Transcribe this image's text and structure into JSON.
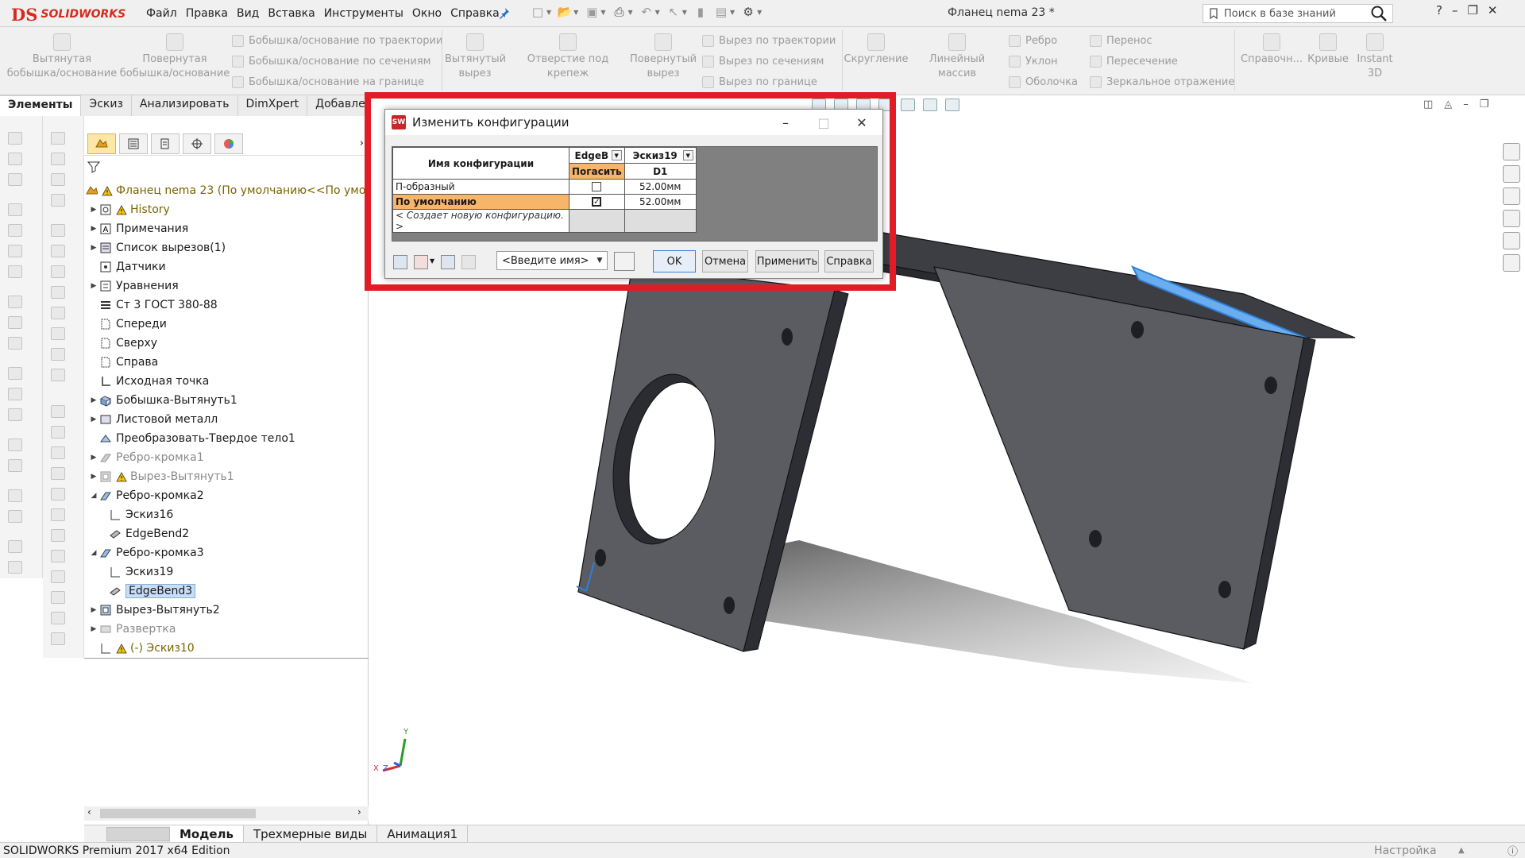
{
  "app": {
    "logo_prefix": "DS",
    "logo_text": "SOLIDWORKS",
    "menus": [
      "Файл",
      "Правка",
      "Вид",
      "Вставка",
      "Инструменты",
      "Окно",
      "Справка"
    ],
    "document_title": "Фланец nema 23 *",
    "search_placeholder": "Поиск в базе знаний",
    "help_glyph": "?"
  },
  "command_manager": {
    "buttons_big": [
      {
        "label": "Вытянутая бобышка/основание"
      },
      {
        "label": "Повернутая бобышка/основание"
      },
      {
        "label": "Вытянутый вырез"
      },
      {
        "label": "Отверстие под крепеж"
      },
      {
        "label": "Повернутый вырез"
      },
      {
        "label": "Скругление"
      },
      {
        "label": "Линейный массив"
      },
      {
        "label": "Справочн..."
      },
      {
        "label": "Кривые"
      },
      {
        "label": "Instant 3D"
      }
    ],
    "buttons_small": [
      "Бобышка/основание по траектории",
      "Бобышка/основание по сечениям",
      "Бобышка/основание на границе",
      "Вырез по траектории",
      "Вырез по сечениям",
      "Вырез по границе",
      "Ребро",
      "Уклон",
      "Оболочка",
      "Перенос",
      "Пересечение",
      "Зеркальное отражение"
    ]
  },
  "tabs": [
    "Элементы",
    "Эскиз",
    "Анализировать",
    "DimXpert",
    "Добавления SOLIDWORKS"
  ],
  "feature_tree": {
    "root": "Фланец nema 23  (По умолчанию<<По умо",
    "items": [
      {
        "label": "History"
      },
      {
        "label": "Примечания"
      },
      {
        "label": "Список вырезов(1)"
      },
      {
        "label": "Датчики"
      },
      {
        "label": "Уравнения"
      },
      {
        "label": "Ст 3 ГОСТ 380-88"
      },
      {
        "label": "Спереди"
      },
      {
        "label": "Сверху"
      },
      {
        "label": "Справа"
      },
      {
        "label": "Исходная точка"
      },
      {
        "label": "Бобышка-Вытянуть1"
      },
      {
        "label": "Листовой металл"
      },
      {
        "label": "Преобразовать-Твердое тело1"
      },
      {
        "label": "Ребро-кромка1"
      },
      {
        "label": "Вырез-Вытянуть1"
      },
      {
        "label": "Ребро-кромка2"
      },
      {
        "label": "Эскиз16"
      },
      {
        "label": "EdgeBend2"
      },
      {
        "label": "Ребро-кромка3"
      },
      {
        "label": "Эскиз19"
      },
      {
        "label": "EdgeBend3"
      },
      {
        "label": "Вырез-Вытянуть2"
      },
      {
        "label": "Развертка"
      },
      {
        "label": "(-) Эскиз10"
      }
    ]
  },
  "dialog": {
    "title": "Изменить конфигурации",
    "col_name_header": "Имя конфигурации",
    "col1_header": "EdgeB",
    "col1_sub": "Погасить",
    "col2_header": "Эскиз19",
    "col2_sub": "D1",
    "rows": [
      {
        "name": "П-образный",
        "suppress": false,
        "d1": "52.00мм"
      },
      {
        "name": "По умолчанию",
        "suppress": true,
        "d1": "52.00мм"
      }
    ],
    "new_row": "< Создает новую конфигурацию. >",
    "name_combo": "<Введите имя>",
    "ok": "OK",
    "cancel": "Отмена",
    "apply": "Применить",
    "help": "Справка"
  },
  "bottom_tabs": [
    "Модель",
    "Трехмерные виды",
    "Анимация1"
  ],
  "status": {
    "left": "SOLIDWORKS Premium 2017 x64 Edition",
    "right": "Настройка"
  },
  "triad": {
    "y": "Y",
    "x": "X",
    "z": "Z"
  },
  "colors": {
    "brand": "#d52b1e",
    "highlight_box": "#e21b24",
    "part": "#5a5c62",
    "selected_edge": "#3b8eea",
    "config_active": "#f7b56a"
  }
}
